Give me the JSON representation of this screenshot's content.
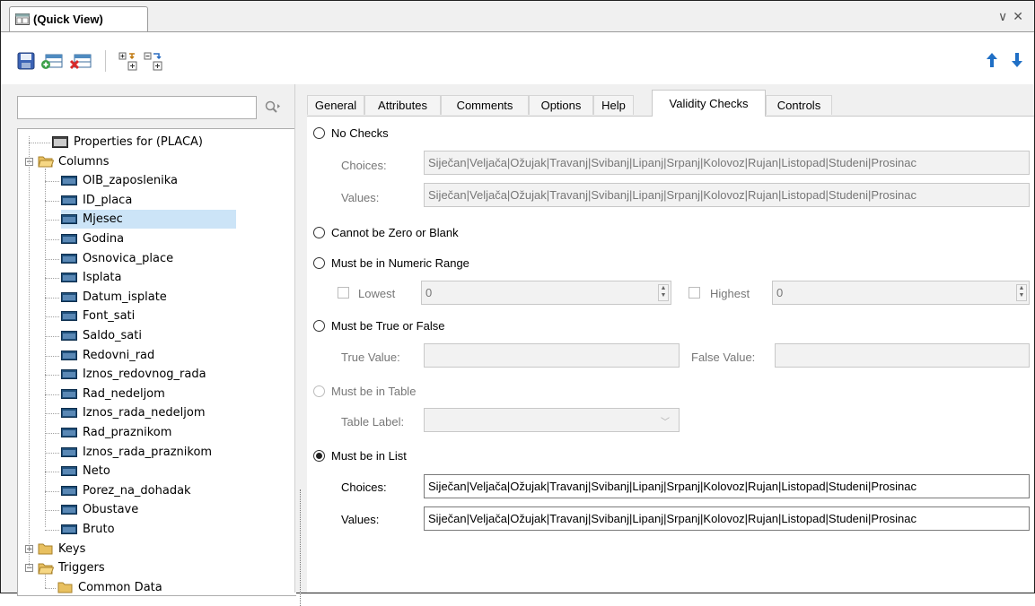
{
  "window": {
    "title": "(Quick View)",
    "controls": [
      "∨",
      "✕"
    ]
  },
  "toolbar": {
    "icons": [
      "save-icon",
      "add-row-icon",
      "delete-row-icon",
      "expand-all-icon",
      "collapse-all-icon"
    ],
    "right_icons": [
      "move-up-icon",
      "move-down-icon"
    ]
  },
  "search": {
    "value": "",
    "placeholder": ""
  },
  "tree": {
    "properties": "Properties for (PLACA)",
    "columns_label": "Columns",
    "columns": [
      "OIB_zaposlenika",
      "ID_placa",
      "Mjesec",
      "Godina",
      "Osnovica_place",
      "Isplata",
      "Datum_isplate",
      "Font_sati",
      "Saldo_sati",
      "Redovni_rad",
      "Iznos_redovnog_rada",
      "Rad_nedeljom",
      "Iznos_rada_nedeljom",
      "Rad_praznikom",
      "Iznos_rada_praznikom",
      "Neto",
      "Porez_na_dohadak",
      "Obustave",
      "Bruto"
    ],
    "selected": "Mjesec",
    "keys_label": "Keys",
    "triggers_label": "Triggers",
    "common_data_label": "Common Data"
  },
  "tabs": [
    "General",
    "Attributes",
    "Comments",
    "Options",
    "Help",
    "Validity Checks",
    "Controls"
  ],
  "active_tab": "Validity Checks",
  "validity": {
    "no_checks": {
      "label": "No Checks",
      "choices_label": "Choices:",
      "choices": "Siječan|Veljača|Ožujak|Travanj|Svibanj|Lipanj|Srpanj|Kolovoz|Rujan|Listopad|Studeni|Prosinac",
      "values_label": "Values:",
      "values": "Siječan|Veljača|Ožujak|Travanj|Svibanj|Lipanj|Srpanj|Kolovoz|Rujan|Listopad|Studeni|Prosinac"
    },
    "not_zero": {
      "label": "Cannot be Zero or Blank"
    },
    "numeric_range": {
      "label": "Must be in Numeric Range",
      "lowest_label": "Lowest",
      "lowest_value": "0",
      "highest_label": "Highest",
      "highest_value": "0"
    },
    "true_false": {
      "label": "Must be True or False",
      "true_label": "True Value:",
      "true_value": "",
      "false_label": "False Value:",
      "false_value": ""
    },
    "in_table": {
      "label": "Must be in Table",
      "table_label": "Table Label:",
      "table_value": ""
    },
    "in_list": {
      "label": "Must be in List",
      "selected": true,
      "choices_label": "Choices:",
      "choices": "Siječan|Veljača|Ožujak|Travanj|Svibanj|Lipanj|Srpanj|Kolovoz|Rujan|Listopad|Studeni|Prosinac",
      "values_label": "Values:",
      "values": "Siječan|Veljača|Ožujak|Travanj|Svibanj|Lipanj|Srpanj|Kolovoz|Rujan|Listopad|Studeni|Prosinac"
    }
  },
  "colors": {
    "selection": "#cce4f7",
    "folder": "#e8c060",
    "accent": "#1f6fc5"
  }
}
